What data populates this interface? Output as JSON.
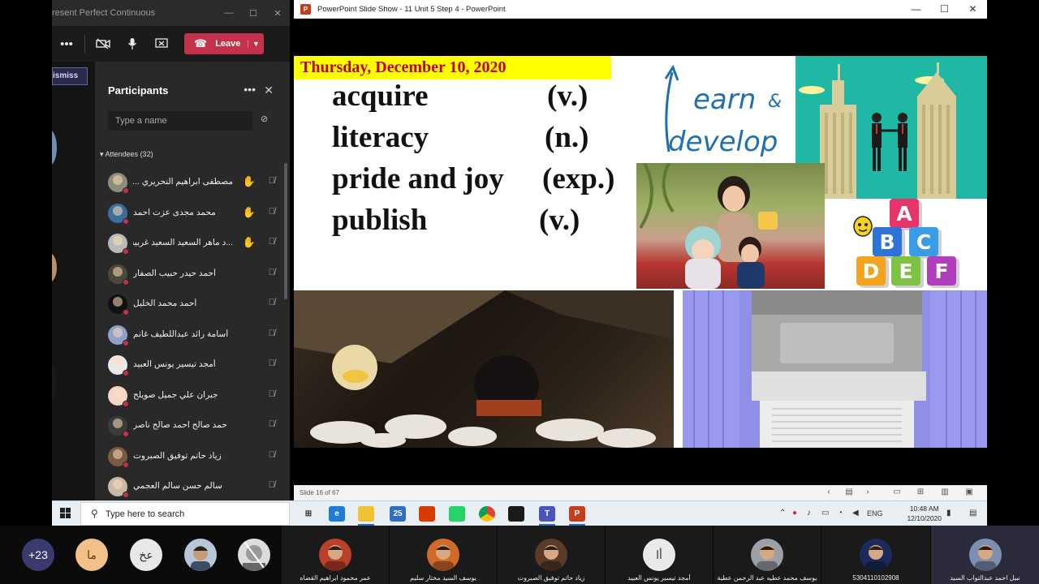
{
  "teams": {
    "window_title": "resent Perfect Continuous",
    "window_controls": [
      "—",
      "☐",
      "✕"
    ],
    "leave_label": "Leave",
    "dismiss_label": "ismiss",
    "stage_avatar": "يم",
    "participants_title": "Participants",
    "search_placeholder": "Type a name",
    "attendees_header": "Attendees (32)",
    "attendees": [
      {
        "name": "مصطفى ابراهيم النحريري ...",
        "hand": true,
        "avatar_color": "#8a8f7a"
      },
      {
        "name": "محمد مجدى عزت احمد",
        "hand": true,
        "avatar_color": "#3d6d9c"
      },
      {
        "name": "...د ماهر السعيد السعيد غربيه",
        "hand": true,
        "avatar_color": "#b9b9b9"
      },
      {
        "name": "أحمد حيدر حبيب الصفار",
        "hand": false,
        "avatar_color": "#4a4a3a"
      },
      {
        "name": "أحمد محمد الخليل",
        "hand": false,
        "avatar_color": "#111111"
      },
      {
        "name": "أسامة رائد عبداللطيف غانم",
        "hand": false,
        "avatar_color": "#8fa1c7"
      },
      {
        "name": "أمجد تيسير يونس العبيد",
        "hand": false,
        "avatar_color": "#e8e8e8"
      },
      {
        "name": "جبران علي جميل صويلح",
        "hand": false,
        "avatar_color": "#f2d6c8"
      },
      {
        "name": "حمد صالح احمد صالح ناصر",
        "hand": false,
        "avatar_color": "#3b3b3b"
      },
      {
        "name": "زياد حاتم توفيق الصبروت",
        "hand": false,
        "avatar_color": "#7a5a40"
      },
      {
        "name": "سالم حسن سالم العجمي",
        "hand": false,
        "avatar_color": "#c9b8a8"
      }
    ]
  },
  "ppt": {
    "window_title": "PowerPoint Slide Show  -  11 Unit 5 Step 4  -  PowerPoint",
    "logo": "P",
    "window_controls": [
      "—",
      "☐",
      "✕"
    ],
    "status_slide": "Slide 16 of 67"
  },
  "slide": {
    "date": "Thursday, December 10, 2020",
    "vocab": [
      {
        "word": "acquire",
        "pos": "(v.)"
      },
      {
        "word": "literacy",
        "pos": "(n.)"
      },
      {
        "word": "pride and joy",
        "pos": "(exp.)"
      },
      {
        "word": "publish",
        "pos": "(v.)"
      }
    ],
    "learn_word": "earn",
    "learn_amp": "&",
    "develop_word": "develop",
    "abc_blocks": [
      "A",
      "B",
      "C",
      "D",
      "E",
      "F"
    ],
    "colors": {
      "date_bg": "#ffff00",
      "date_text": "#c00000",
      "learn_blue": "#1e6fb3",
      "city_teal": "#1fb8a5",
      "press_purple": "#8f8fe8"
    }
  },
  "taskbar": {
    "search_placeholder": "Type here to search",
    "apps": [
      {
        "icon": "task-view-icon",
        "label": "⊞"
      },
      {
        "icon": "edge-icon",
        "label": "e"
      },
      {
        "icon": "file-explorer-icon",
        "label": ""
      },
      {
        "icon": "mail-icon",
        "label": "25"
      },
      {
        "icon": "office-icon",
        "label": ""
      },
      {
        "icon": "whatsapp-icon",
        "label": ""
      },
      {
        "icon": "chrome-icon",
        "label": ""
      },
      {
        "icon": "photos-icon",
        "label": ""
      },
      {
        "icon": "teams-icon",
        "label": "T"
      },
      {
        "icon": "powerpoint-icon",
        "label": "P"
      }
    ],
    "language": "ENG",
    "time": "10:48 AM",
    "date": "12/10/2020"
  },
  "gallery": {
    "overflow_count": "+23",
    "circles": [
      {
        "text": "ما",
        "bg": "#f3c08a",
        "fg": "#5a3a10"
      },
      {
        "text": "عخ",
        "bg": "#e8e8e8",
        "fg": "#333333"
      }
    ],
    "tiles": [
      {
        "name": "عمر محمود ابراهيم القضاه"
      },
      {
        "name": "يوسف السيد مختار سليم"
      },
      {
        "name": "زياد حاتم توفيق الصبروت"
      },
      {
        "name": "أمجد تيسير يونس العبيد",
        "initial": "أا"
      },
      {
        "name": "يوسف محمد عطيه عبد الرحمن عطية"
      },
      {
        "name": "5304110102908"
      },
      {
        "name": "نبيل احمد عبدالتواب السيد"
      }
    ]
  }
}
